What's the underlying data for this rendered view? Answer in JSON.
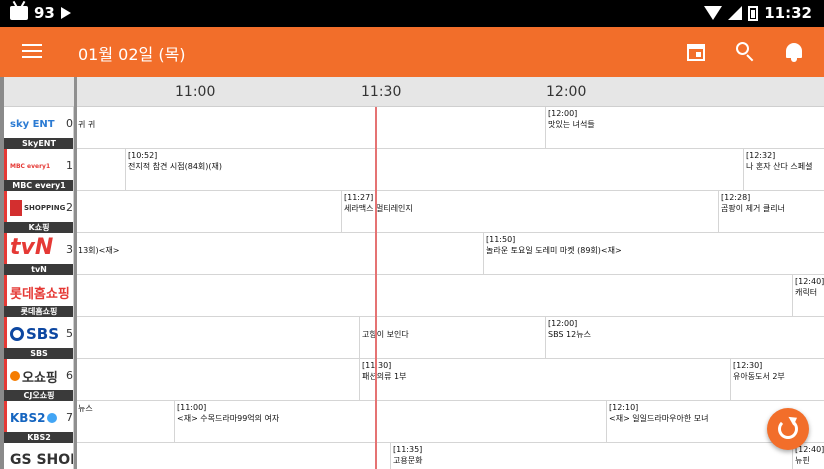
{
  "status_bar": {
    "battery_text": "93",
    "clock": "11:32"
  },
  "toolbar": {
    "date": "01월 02일 (목)"
  },
  "ruler": {
    "times": [
      "11:00",
      "11:30",
      "12:00"
    ]
  },
  "channels": [
    {
      "logo": "sky ENT",
      "number": "0",
      "name": "SkyENT",
      "logo_color": "#2b7bd3"
    },
    {
      "logo": "MBC every1",
      "number": "1",
      "name": "MBC every1",
      "logo_color": "#e53935"
    },
    {
      "logo": "SHOPPING",
      "number": "2",
      "name": "K쇼핑",
      "logo_color": "#d32f2f"
    },
    {
      "logo": "tvN",
      "number": "3",
      "name": "tvN",
      "logo_color": "#e53935"
    },
    {
      "logo": "롯데홈쇼핑",
      "number": "",
      "name": "롯데홈쇼핑",
      "logo_color": "#e53935"
    },
    {
      "logo": "SBS",
      "number": "5",
      "name": "SBS",
      "logo_color": "#0d47a1"
    },
    {
      "logo": "오쇼핑",
      "number": "6",
      "name": "CJ오쇼핑",
      "logo_color": "#333333"
    },
    {
      "logo": "KBS2",
      "number": "7",
      "name": "KBS2",
      "logo_color": "#1565c0"
    },
    {
      "logo": "GS SHOP",
      "number": "",
      "name": "",
      "logo_color": "#333333"
    }
  ],
  "programs": [
    [
      {
        "time": "",
        "title": "귀 귀"
      },
      {
        "time": "[12:00]",
        "title": "맛있는 녀석들"
      }
    ],
    [
      {
        "time": "[10:52]",
        "title": "전지적 참견 시점(84회)(재)"
      },
      {
        "time": "[12:32]",
        "title": "나 혼자 산다 스페셜"
      }
    ],
    [
      {
        "time": "[11:27]",
        "title": "세라맥스 멀티레인지"
      },
      {
        "time": "[12:28]",
        "title": "곰팡이 제거 클리너"
      }
    ],
    [
      {
        "time": "",
        "title": "13회)<재>"
      },
      {
        "time": "[11:50]",
        "title": "놀라운 토요일 도레미 마켓 (89회)<재>"
      }
    ],
    [
      {
        "time": "[12:40]",
        "title": "캐릭터"
      }
    ],
    [
      {
        "time": "",
        "title": "고향이 보인다"
      },
      {
        "time": "[12:00]",
        "title": "SBS 12뉴스"
      }
    ],
    [
      {
        "time": "[11:30]",
        "title": "패션의류 1부"
      },
      {
        "time": "[12:30]",
        "title": "유아동도서 2부"
      }
    ],
    [
      {
        "time": "",
        "title": "뉴스"
      },
      {
        "time": "[11:00]",
        "title": "<재> 수목드라마99억의 여자"
      },
      {
        "time": "[12:10]",
        "title": "<재> 일일드라마우아한 모녀"
      }
    ],
    [
      {
        "time": "[11:35]",
        "title": "고용문화"
      },
      {
        "time": "[12:40]",
        "title": "뉴핀"
      }
    ]
  ]
}
